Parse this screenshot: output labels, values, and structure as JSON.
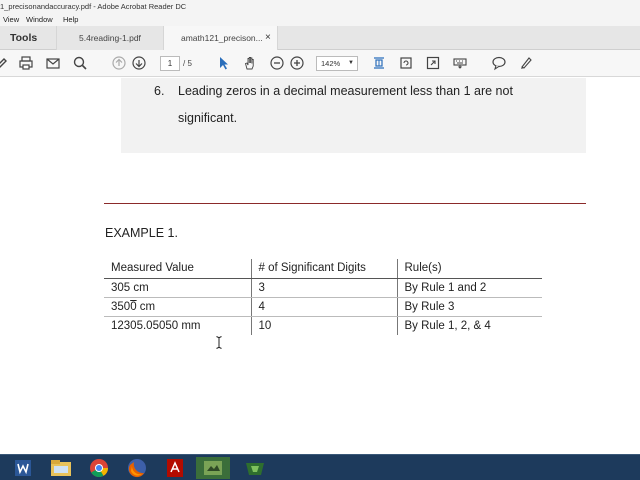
{
  "window": {
    "title": "1_precisonandaccuracy.pdf - Adobe Acrobat Reader DC"
  },
  "menu": [
    "View",
    "Window",
    "Help"
  ],
  "tabs": {
    "tools": "Tools",
    "items": [
      "5.4reading-1.pdf",
      "amath121_precison..."
    ],
    "close_glyph": "×"
  },
  "toolbar": {
    "page_current": "1",
    "page_total": "/ 5",
    "zoom": "142%"
  },
  "document": {
    "rule_number": "6.",
    "rule_text_line1": "Leading zeros in a decimal measurement less than 1 are not",
    "rule_text_line2": "significant.",
    "example_heading": "EXAMPLE 1.",
    "table": {
      "headers": [
        "Measured Value",
        "# of Significant Digits",
        "Rule(s)"
      ],
      "rows": [
        {
          "value": "305 cm",
          "digits": "3",
          "rules": "By Rule 1 and 2"
        },
        {
          "value_pre": "350",
          "value_bar": "0",
          "value_post": " cm",
          "digits": "4",
          "rules": "By Rule 3"
        },
        {
          "value": "12305.05050 mm",
          "digits": "10",
          "rules": "By Rule 1, 2, & 4"
        }
      ]
    }
  },
  "icons": {
    "toolbar": [
      "hand-tool-icon",
      "print-icon",
      "email-icon",
      "search-icon",
      "page-up-icon",
      "page-down-icon",
      "select-pointer-icon",
      "pan-hand-icon",
      "zoom-out-icon",
      "zoom-in-icon",
      "fit-page-icon",
      "rotate-icon",
      "full-screen-icon",
      "keyboard-icon",
      "comment-icon",
      "highlight-pen-icon"
    ],
    "taskbar": [
      "word-icon",
      "file-explorer-icon",
      "chrome-icon",
      "firefox-icon",
      "acrobat-icon",
      "media-icon",
      "camtasia-icon"
    ]
  },
  "colors": {
    "divider": "#8b2a2a",
    "taskbar": "#1d3a5c",
    "accent_blue": "#2a6ebb"
  }
}
